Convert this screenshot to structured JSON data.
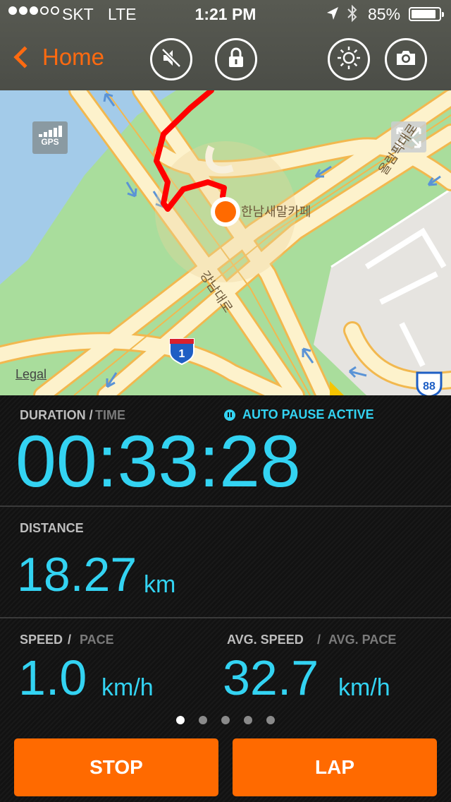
{
  "status_bar": {
    "carrier": "SKT",
    "network": "LTE",
    "time": "1:21 PM",
    "battery": "85%",
    "battery_level": 0.85
  },
  "nav": {
    "back_label": "Home",
    "buttons": [
      "mute-icon",
      "lock-icon",
      "brightness-icon",
      "camera-icon"
    ]
  },
  "map": {
    "gps_label": "GPS",
    "place_label": "한남새말카페",
    "road_label_1": "강남대로",
    "road_label_2": "올림픽대로",
    "route_badge_1": "1",
    "route_badge_2": "88",
    "legal_label": "Legal"
  },
  "stats": {
    "duration_label": "DURATION /",
    "time_label": "TIME",
    "auto_pause": "AUTO PAUSE ACTIVE",
    "duration_value": "00:33:28",
    "distance_label": "DISTANCE",
    "distance_value": "18.27",
    "distance_unit": "km",
    "speed_label": "SPEED",
    "speed_slash": "/",
    "pace_label": "PACE",
    "speed_value": "1.0",
    "speed_unit": "km/h",
    "avg_speed_label": "AVG. SPEED",
    "avg_slash": "/",
    "avg_pace_label": "AVG. PACE",
    "avg_speed_value": "32.7",
    "avg_speed_unit": "km/h"
  },
  "pager": {
    "count": 5,
    "active": 1
  },
  "actions": {
    "stop_label": "STOP",
    "lap_label": "LAP"
  },
  "colors": {
    "accent": "#ff6a00",
    "value": "#33d3f2",
    "route": "#ff0000"
  }
}
